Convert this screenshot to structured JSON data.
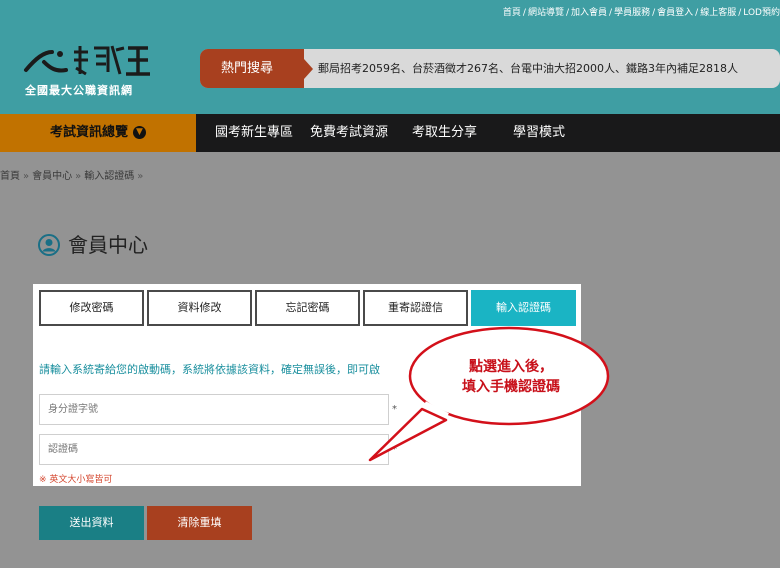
{
  "top_links": [
    "首頁",
    "網站導覽",
    "加入會員",
    "學員服務",
    "會員登入",
    "線上客服",
    "LOD預約"
  ],
  "logo": {
    "sub": "全國最大公職資訊網"
  },
  "hot_search": {
    "label": "熱門搜尋",
    "text": "郵局招考2059名、台菸酒徵才267名、台電中油大招2000人、鐵路3年內補足2818人"
  },
  "nav": {
    "exam": "考試資訊總覽",
    "links": [
      "國考新生專區",
      "免費考試資源",
      "考取生分享",
      "學習模式"
    ]
  },
  "breadcrumb": [
    "首頁",
    "會員中心",
    "輸入認證碼"
  ],
  "page_title": "會員中心",
  "tabs": [
    "修改密碼",
    "資料修改",
    "忘記密碼",
    "重寄認證信",
    "輸入認證碼"
  ],
  "hint": "請輸入系統寄給您的啟動碼，系統將依據該資料，確定無誤後，即可啟",
  "fields": {
    "id_placeholder": "身分證字號",
    "code_placeholder": "認證碼",
    "required_mark": "*"
  },
  "note": "※ 英文大小寫皆可",
  "buttons": {
    "submit": "送出資料",
    "clear": "清除重填"
  },
  "callout": {
    "line1": "點選進入後，",
    "line2": "填入手機認證碼"
  },
  "colors": {
    "header": "#3f9ea3",
    "accent_orange": "#c17200",
    "hot_red": "#a8401f",
    "teal_button": "#1a7f85",
    "active_tab": "#1ab4c4",
    "callout_red": "#d3101a"
  }
}
